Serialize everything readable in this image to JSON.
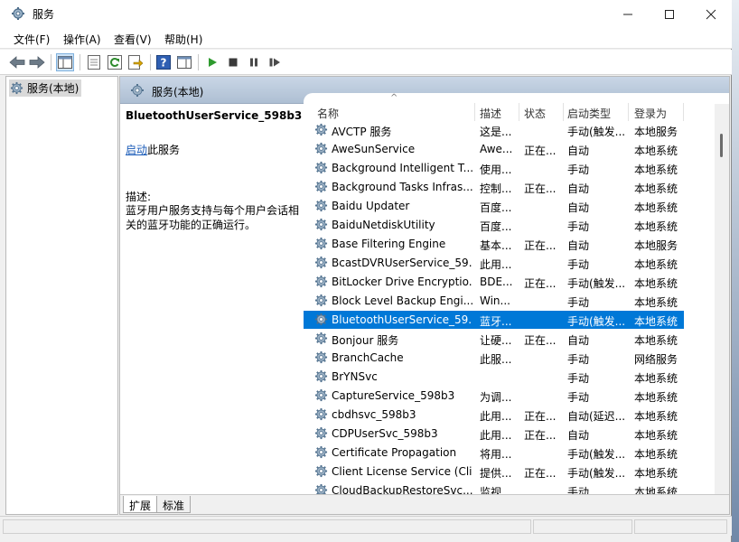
{
  "window": {
    "title": "服务",
    "controls": {
      "minimize": "—",
      "maximize": "☐",
      "close": "✕"
    }
  },
  "menu": [
    "文件(F)",
    "操作(A)",
    "查看(V)",
    "帮助(H)"
  ],
  "tree": {
    "root_label": "服务(本地)"
  },
  "pane": {
    "header": "服务(本地)"
  },
  "description": {
    "service_name": "BluetoothUserService_598b3",
    "start_link": "启动",
    "start_suffix": "此服务",
    "label": "描述:",
    "text": "蓝牙用户服务支持与每个用户会话相关的蓝牙功能的正确运行。"
  },
  "columns": {
    "name": "名称",
    "description": "描述",
    "status": "状态",
    "startup": "启动类型",
    "logon": "登录为"
  },
  "rows": [
    {
      "name": "AVCTP 服务",
      "desc": "这是...",
      "status": "",
      "startup": "手动(触发...",
      "logon": "本地服务"
    },
    {
      "name": "AweSunService",
      "desc": "Awe...",
      "status": "正在...",
      "startup": "自动",
      "logon": "本地系统"
    },
    {
      "name": "Background Intelligent T...",
      "desc": "使用...",
      "status": "",
      "startup": "手动",
      "logon": "本地系统"
    },
    {
      "name": "Background Tasks Infras...",
      "desc": "控制...",
      "status": "正在...",
      "startup": "自动",
      "logon": "本地系统"
    },
    {
      "name": "Baidu Updater",
      "desc": "百度...",
      "status": "",
      "startup": "自动",
      "logon": "本地系统"
    },
    {
      "name": "BaiduNetdiskUtility",
      "desc": "百度...",
      "status": "",
      "startup": "手动",
      "logon": "本地系统"
    },
    {
      "name": "Base Filtering Engine",
      "desc": "基本...",
      "status": "正在...",
      "startup": "自动",
      "logon": "本地服务"
    },
    {
      "name": "BcastDVRUserService_59...",
      "desc": "此用...",
      "status": "",
      "startup": "手动",
      "logon": "本地系统"
    },
    {
      "name": "BitLocker Drive Encryptio...",
      "desc": "BDE...",
      "status": "正在...",
      "startup": "手动(触发...",
      "logon": "本地系统"
    },
    {
      "name": "Block Level Backup Engi...",
      "desc": "Win...",
      "status": "",
      "startup": "手动",
      "logon": "本地系统"
    },
    {
      "name": "BluetoothUserService_59...",
      "desc": "蓝牙...",
      "status": "",
      "startup": "手动(触发...",
      "logon": "本地系统",
      "selected": true
    },
    {
      "name": "Bonjour 服务",
      "desc": "让硬...",
      "status": "正在...",
      "startup": "自动",
      "logon": "本地系统"
    },
    {
      "name": "BranchCache",
      "desc": "此服...",
      "status": "",
      "startup": "手动",
      "logon": "网络服务"
    },
    {
      "name": "BrYNSvc",
      "desc": "",
      "status": "",
      "startup": "手动",
      "logon": "本地系统"
    },
    {
      "name": "CaptureService_598b3",
      "desc": "为调...",
      "status": "",
      "startup": "手动",
      "logon": "本地系统"
    },
    {
      "name": "cbdhsvc_598b3",
      "desc": "此用...",
      "status": "正在...",
      "startup": "自动(延迟...",
      "logon": "本地系统"
    },
    {
      "name": "CDPUserSvc_598b3",
      "desc": "此用...",
      "status": "正在...",
      "startup": "自动",
      "logon": "本地系统"
    },
    {
      "name": "Certificate Propagation",
      "desc": "将用...",
      "status": "",
      "startup": "手动(触发...",
      "logon": "本地系统"
    },
    {
      "name": "Client License Service (Cli...",
      "desc": "提供...",
      "status": "正在...",
      "startup": "手动(触发...",
      "logon": "本地系统"
    },
    {
      "name": "CloudBackupRestoreSvc...",
      "desc": "监视...",
      "status": "",
      "startup": "手动",
      "logon": "本地系统"
    }
  ],
  "tabs": [
    "扩展",
    "标准"
  ],
  "colors": {
    "selection": "#0078d7",
    "link": "#1a5bb8",
    "header": "#b9c8da"
  }
}
